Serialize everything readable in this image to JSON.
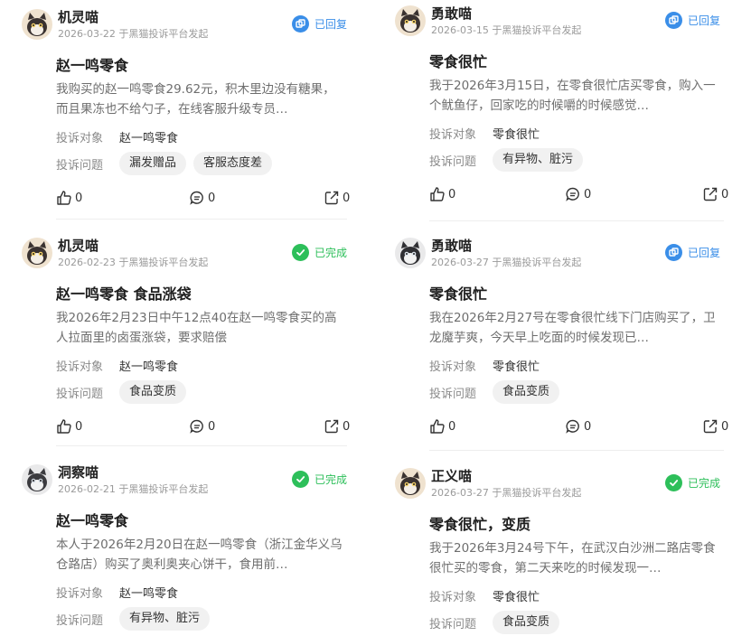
{
  "labels": {
    "target": "投诉对象",
    "issue": "投诉问题"
  },
  "colors": {
    "done": "#2dbf5a",
    "replied": "#3a8ee8"
  },
  "cards": [
    {
      "user": "机灵喵",
      "avatar_icon": "cat-avatar-icon",
      "date": "2026-03-22 于黑猫投诉平台发起",
      "status": "已回复",
      "title": "赵一鸣零食",
      "desc": "我购买的赵一鸣零食29.62元，积木里边没有糖果，而且果冻也不给勺子，在线客服升级专员…",
      "target": "赵一鸣零食",
      "tags": [
        "漏发赠品",
        "客服态度差"
      ],
      "likes": "0",
      "comments": "0",
      "shares": "0"
    },
    {
      "user": "勇敢喵",
      "avatar_icon": "cat-avatar-icon",
      "date": "2026-03-15 于黑猫投诉平台发起",
      "status": "已回复",
      "title": "零食很忙",
      "desc": "我于2026年3月15日，在零食很忙店买零食，购入一个鱿鱼仔，回家吃的时候嚼的时候感觉…",
      "target": "零食很忙",
      "tags": [
        "有异物、脏污"
      ],
      "likes": "0",
      "comments": "0",
      "shares": "0"
    },
    {
      "user": "机灵喵",
      "avatar_icon": "cat-avatar-icon",
      "date": "2026-02-23 于黑猫投诉平台发起",
      "status": "已完成",
      "title": "赵一鸣零食 食品涨袋",
      "desc": "我2026年2月23日中午12点40在赵一鸣零食买的高人拉面里的卤蛋涨袋，要求赔偿",
      "target": "赵一鸣零食",
      "tags": [
        "食品变质"
      ],
      "likes": "0",
      "comments": "0",
      "shares": "0"
    },
    {
      "user": "勇敢喵",
      "avatar_icon": "cat-avatar-icon",
      "date": "2026-03-27 于黑猫投诉平台发起",
      "status": "已回复",
      "title": "零食很忙",
      "desc": "我在2026年2月27号在零食很忙线下门店购买了，卫龙魔芋爽，今天早上吃面的时候发现已…",
      "target": "零食很忙",
      "tags": [
        "食品变质"
      ],
      "likes": "0",
      "comments": "0",
      "shares": "0"
    },
    {
      "user": "洞察喵",
      "avatar_icon": "cat-avatar-icon",
      "date": "2026-02-21 于黑猫投诉平台发起",
      "status": "已完成",
      "title": "赵一鸣零食",
      "desc": "本人于2026年2月20日在赵一鸣零食（浙江金华义乌仓路店）购买了奥利奥夹心饼干，食用前…",
      "target": "赵一鸣零食",
      "tags": [
        "有异物、脏污"
      ],
      "likes": "0",
      "comments": "0",
      "shares": "0"
    },
    {
      "user": "正义喵",
      "avatar_icon": "cat-avatar-icon",
      "date": "2026-03-27 于黑猫投诉平台发起",
      "status": "已完成",
      "title": "零食很忙，变质",
      "desc": "我于2026年3月24号下午，在武汉白沙洲二路店零食很忙买的零食，第二天来吃的时候发现一…",
      "target": "零食很忙",
      "tags": [
        "食品变质"
      ],
      "likes": "0",
      "comments": "0",
      "shares": "0"
    }
  ]
}
